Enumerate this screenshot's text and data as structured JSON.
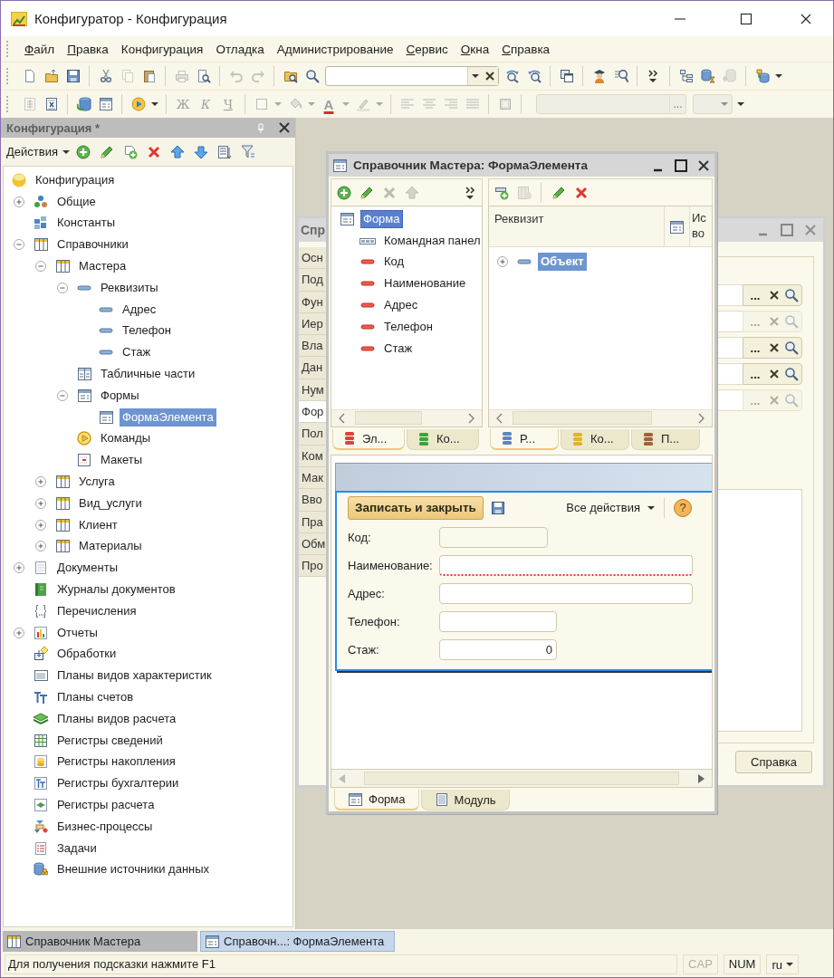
{
  "window": {
    "title": "Конфигуратор - Конфигурация"
  },
  "menu": [
    {
      "label": "Файл",
      "underline_first": true
    },
    {
      "label": "Правка",
      "underline_first": true
    },
    {
      "label": "Конфигурация",
      "underline_first": false
    },
    {
      "label": "Отладка",
      "underline_first": false
    },
    {
      "label": "Администрирование",
      "underline_first": false
    },
    {
      "label": "Сервис",
      "underline_first": true
    },
    {
      "label": "Окна",
      "underline_first": true
    },
    {
      "label": "Справка",
      "underline_first": true
    }
  ],
  "toolbar1": {
    "groups": [
      {
        "items": [
          {
            "kind": "new",
            "disabled": false
          },
          {
            "kind": "open",
            "disabled": false
          },
          {
            "kind": "save",
            "disabled": false
          }
        ]
      },
      {
        "items": [
          {
            "kind": "cut",
            "disabled": false
          },
          {
            "kind": "copy",
            "disabled": true
          },
          {
            "kind": "paste",
            "disabled": false
          }
        ]
      },
      {
        "items": [
          {
            "kind": "print",
            "disabled": true
          },
          {
            "kind": "preview",
            "disabled": false
          }
        ]
      },
      {
        "items": [
          {
            "kind": "undo",
            "disabled": true
          },
          {
            "kind": "redo",
            "disabled": true
          }
        ]
      },
      {
        "items": [
          {
            "kind": "folder-search",
            "disabled": false
          },
          {
            "kind": "search",
            "disabled": false
          },
          {
            "kind": "search-field",
            "disabled": false
          },
          {
            "kind": "find-next",
            "disabled": false
          },
          {
            "kind": "find-prev",
            "disabled": false
          }
        ]
      },
      {
        "items": [
          {
            "kind": "windows",
            "disabled": false
          }
        ]
      },
      {
        "items": [
          {
            "kind": "wizard",
            "disabled": false
          },
          {
            "kind": "find-ref",
            "disabled": false
          }
        ]
      },
      {
        "items": [
          {
            "kind": "more",
            "disabled": false
          }
        ]
      },
      {
        "items": [
          {
            "kind": "struct",
            "disabled": false
          },
          {
            "kind": "db-wait",
            "disabled": false
          },
          {
            "kind": "db-update",
            "disabled": true
          }
        ]
      },
      {
        "items": [
          {
            "kind": "db-config",
            "disabled": false
          },
          {
            "kind": "caret",
            "disabled": false
          }
        ]
      }
    ]
  },
  "toolbar2": {
    "groups": [
      {
        "items": [
          {
            "kind": "grid-doc",
            "disabled": true
          },
          {
            "kind": "doc-x",
            "disabled": false
          }
        ]
      },
      {
        "items": [
          {
            "kind": "db-sync",
            "disabled": false
          },
          {
            "kind": "table-form",
            "disabled": false
          }
        ]
      },
      {
        "items": [
          {
            "kind": "play",
            "disabled": false
          },
          {
            "kind": "caret",
            "disabled": false
          }
        ]
      },
      {
        "items": [
          {
            "kind": "bold",
            "label": "Ж",
            "disabled": true
          },
          {
            "kind": "italic",
            "label": "К",
            "disabled": true
          },
          {
            "kind": "underline",
            "label": "Ч",
            "disabled": true
          }
        ]
      },
      {
        "items": [
          {
            "kind": "rect",
            "disabled": true
          },
          {
            "kind": "caret",
            "disabled": true
          },
          {
            "kind": "bucket",
            "disabled": true
          },
          {
            "kind": "caret",
            "disabled": true
          },
          {
            "kind": "font-color",
            "label": "A",
            "disabled": true
          },
          {
            "kind": "caret",
            "disabled": true
          },
          {
            "kind": "marker",
            "disabled": true
          },
          {
            "kind": "caret",
            "disabled": true
          }
        ]
      },
      {
        "items": [
          {
            "kind": "align-left",
            "disabled": true
          },
          {
            "kind": "align-center",
            "disabled": true
          },
          {
            "kind": "align-right",
            "disabled": true
          },
          {
            "kind": "align-justify",
            "disabled": true
          }
        ]
      },
      {
        "items": [
          {
            "kind": "frame",
            "disabled": true
          }
        ]
      },
      {
        "items": [
          {
            "kind": "text-field",
            "label": "...",
            "disabled": true
          },
          {
            "kind": "combo",
            "disabled": true
          },
          {
            "kind": "caret",
            "disabled": false
          }
        ]
      }
    ]
  },
  "config_panel": {
    "title": "Конфигурация *",
    "actions": "Действия",
    "tools": [
      {
        "kind": "add",
        "disabled": false
      },
      {
        "kind": "pencil",
        "disabled": false
      },
      {
        "kind": "add-doc",
        "disabled": false
      },
      {
        "kind": "delete",
        "disabled": false
      },
      {
        "kind": "up",
        "disabled": false
      },
      {
        "kind": "down",
        "disabled": false
      },
      {
        "kind": "list",
        "disabled": false
      },
      {
        "kind": "filter",
        "disabled": false
      }
    ],
    "tree": [
      {
        "label": "Конфигурация",
        "kind": "config",
        "selected": false,
        "children": [
          {
            "label": "Общие",
            "kind": "common",
            "expanded": false,
            "selected": false
          },
          {
            "label": "Константы",
            "kind": "constants",
            "selected": false
          },
          {
            "label": "Справочники",
            "kind": "catalog",
            "expanded": true,
            "selected": false,
            "children": [
              {
                "label": "Мастера",
                "kind": "catalog",
                "expanded": true,
                "selected": false,
                "children": [
                  {
                    "label": "Реквизиты",
                    "kind": "attribute",
                    "expanded": true,
                    "selected": false,
                    "children": [
                      {
                        "label": "Адрес",
                        "kind": "attribute",
                        "selected": false
                      },
                      {
                        "label": "Телефон",
                        "kind": "attribute",
                        "selected": false
                      },
                      {
                        "label": "Стаж",
                        "kind": "attribute",
                        "selected": false
                      }
                    ]
                  },
                  {
                    "label": "Табличные части",
                    "kind": "tabular",
                    "selected": false
                  },
                  {
                    "label": "Формы",
                    "kind": "form",
                    "expanded": true,
                    "selected": false,
                    "children": [
                      {
                        "label": "ФормаЭлемента",
                        "kind": "form",
                        "selected": true
                      }
                    ]
                  },
                  {
                    "label": "Команды",
                    "kind": "command",
                    "selected": false
                  },
                  {
                    "label": "Макеты",
                    "kind": "template",
                    "selected": false
                  }
                ]
              },
              {
                "label": "Услуга",
                "kind": "catalog",
                "expanded": false,
                "selected": false
              },
              {
                "label": "Вид_услуги",
                "kind": "catalog",
                "expanded": false,
                "selected": false
              },
              {
                "label": "Клиент",
                "kind": "catalog",
                "expanded": false,
                "selected": false
              },
              {
                "label": "Материалы",
                "kind": "catalog",
                "expanded": false,
                "selected": false
              }
            ]
          },
          {
            "label": "Документы",
            "kind": "document",
            "expanded": false,
            "selected": false
          },
          {
            "label": "Журналы документов",
            "kind": "journal",
            "selected": false
          },
          {
            "label": "Перечисления",
            "kind": "enum",
            "selected": false
          },
          {
            "label": "Отчеты",
            "kind": "report",
            "expanded": false,
            "selected": false
          },
          {
            "label": "Обработки",
            "kind": "processing",
            "selected": false
          },
          {
            "label": "Планы видов характеристик",
            "kind": "char-plan",
            "selected": false
          },
          {
            "label": "Планы счетов",
            "kind": "accounts",
            "selected": false
          },
          {
            "label": "Планы видов расчета",
            "kind": "calc-plan",
            "selected": false
          },
          {
            "label": "Регистры сведений",
            "kind": "info-register",
            "selected": false
          },
          {
            "label": "Регистры накопления",
            "kind": "accum-register",
            "selected": false
          },
          {
            "label": "Регистры бухгалтерии",
            "kind": "acc-register",
            "selected": false
          },
          {
            "label": "Регистры расчета",
            "kind": "calc-register",
            "selected": false
          },
          {
            "label": "Бизнес-процессы",
            "kind": "process",
            "selected": false
          },
          {
            "label": "Задачи",
            "kind": "task",
            "selected": false
          },
          {
            "label": "Внешние источники данных",
            "kind": "external",
            "selected": false
          }
        ]
      }
    ]
  },
  "back_window": {
    "title": "Спр",
    "side_tabs": [
      {
        "label": "Осн",
        "selected": false
      },
      {
        "label": "Под",
        "selected": false
      },
      {
        "label": "Фун",
        "selected": false
      },
      {
        "label": "Иер",
        "selected": false
      },
      {
        "label": "Вла",
        "selected": false
      },
      {
        "label": "Дан",
        "selected": false
      },
      {
        "label": "Нум",
        "selected": false
      },
      {
        "label": "Фор",
        "selected": true
      },
      {
        "label": "Пол",
        "selected": false
      },
      {
        "label": "Ком",
        "selected": false
      },
      {
        "label": "Мак",
        "selected": false
      },
      {
        "label": "Вво",
        "selected": false
      },
      {
        "label": "Пра",
        "selected": false
      },
      {
        "label": "Обм",
        "selected": false
      },
      {
        "label": "Про",
        "selected": false
      }
    ],
    "fields": [
      {
        "button": "...",
        "disabled": false
      },
      {
        "button": "...",
        "disabled": true
      },
      {
        "button": "...",
        "disabled": false
      },
      {
        "button": "...",
        "disabled": false
      },
      {
        "button": "...",
        "disabled": true
      }
    ],
    "buttons": [
      "Справка"
    ]
  },
  "designer": {
    "title": "Справочник Мастера: ФормаЭлемента",
    "elements": {
      "tools": [
        {
          "kind": "add",
          "disabled": false
        },
        {
          "kind": "pencil",
          "disabled": false
        },
        {
          "kind": "delete",
          "disabled": true
        },
        {
          "kind": "up",
          "disabled": true
        }
      ],
      "tree": [
        {
          "label": "Форма",
          "kind": "form",
          "selected": true,
          "children": [
            {
              "label": "Командная панел",
              "kind": "commandbar",
              "selected": false
            },
            {
              "label": "Код",
              "kind": "field",
              "selected": false
            },
            {
              "label": "Наименование",
              "kind": "field",
              "selected": false
            },
            {
              "label": "Адрес",
              "kind": "field",
              "selected": false
            },
            {
              "label": "Телефон",
              "kind": "field",
              "selected": false
            },
            {
              "label": "Стаж",
              "kind": "field",
              "selected": false
            }
          ]
        }
      ],
      "tabs": [
        {
          "label": "Эл...",
          "color": "#e0413a",
          "selected": true
        },
        {
          "label": "Ко...",
          "color": "#3fa33a",
          "selected": false
        }
      ]
    },
    "attributes": {
      "tools": [
        {
          "kind": "add-attr",
          "disabled": false
        },
        {
          "kind": "grid-add",
          "disabled": true
        },
        {
          "kind": "pencil",
          "disabled": false
        },
        {
          "kind": "delete",
          "disabled": false
        }
      ],
      "columns": [
        "Реквизит",
        "Ис во"
      ],
      "tree": [
        {
          "label": "Объект",
          "kind": "attribute",
          "expanded": false,
          "selected": true
        }
      ],
      "tabs": [
        {
          "label": "Р...",
          "color": "#5f86be",
          "selected": true
        },
        {
          "label": "Ко...",
          "color": "#e3b321",
          "selected": false
        },
        {
          "label": "П...",
          "color": "#a0603a",
          "selected": false
        }
      ]
    },
    "form": {
      "primary": "Записать и закрыть",
      "all_actions": "Все действия",
      "help": "?",
      "fields": [
        {
          "label": "Код:",
          "disabled": true,
          "required": false
        },
        {
          "label": "Наименование:",
          "disabled": false,
          "required": true
        },
        {
          "label": "Адрес:",
          "disabled": false,
          "required": false
        },
        {
          "label": "Телефон:",
          "disabled": false,
          "required": false
        },
        {
          "label": "Стаж:",
          "value": "0",
          "disabled": false,
          "required": false
        }
      ]
    },
    "tabs": [
      {
        "label": "Форма",
        "kind": "form",
        "selected": true
      },
      {
        "label": "Модуль",
        "kind": "module",
        "selected": false
      }
    ]
  },
  "window_tabs": [
    {
      "label": "Справочник Мастера",
      "kind": "catalog",
      "selected": false
    },
    {
      "label": "Справочн...: ФормаЭлемента",
      "kind": "form",
      "selected": true
    }
  ],
  "status_bar": {
    "hint": "Для получения подсказки нажмите F1",
    "indicators": [
      {
        "label": "CAP",
        "on": false
      },
      {
        "label": "NUM",
        "on": true
      }
    ],
    "language": "ru"
  }
}
